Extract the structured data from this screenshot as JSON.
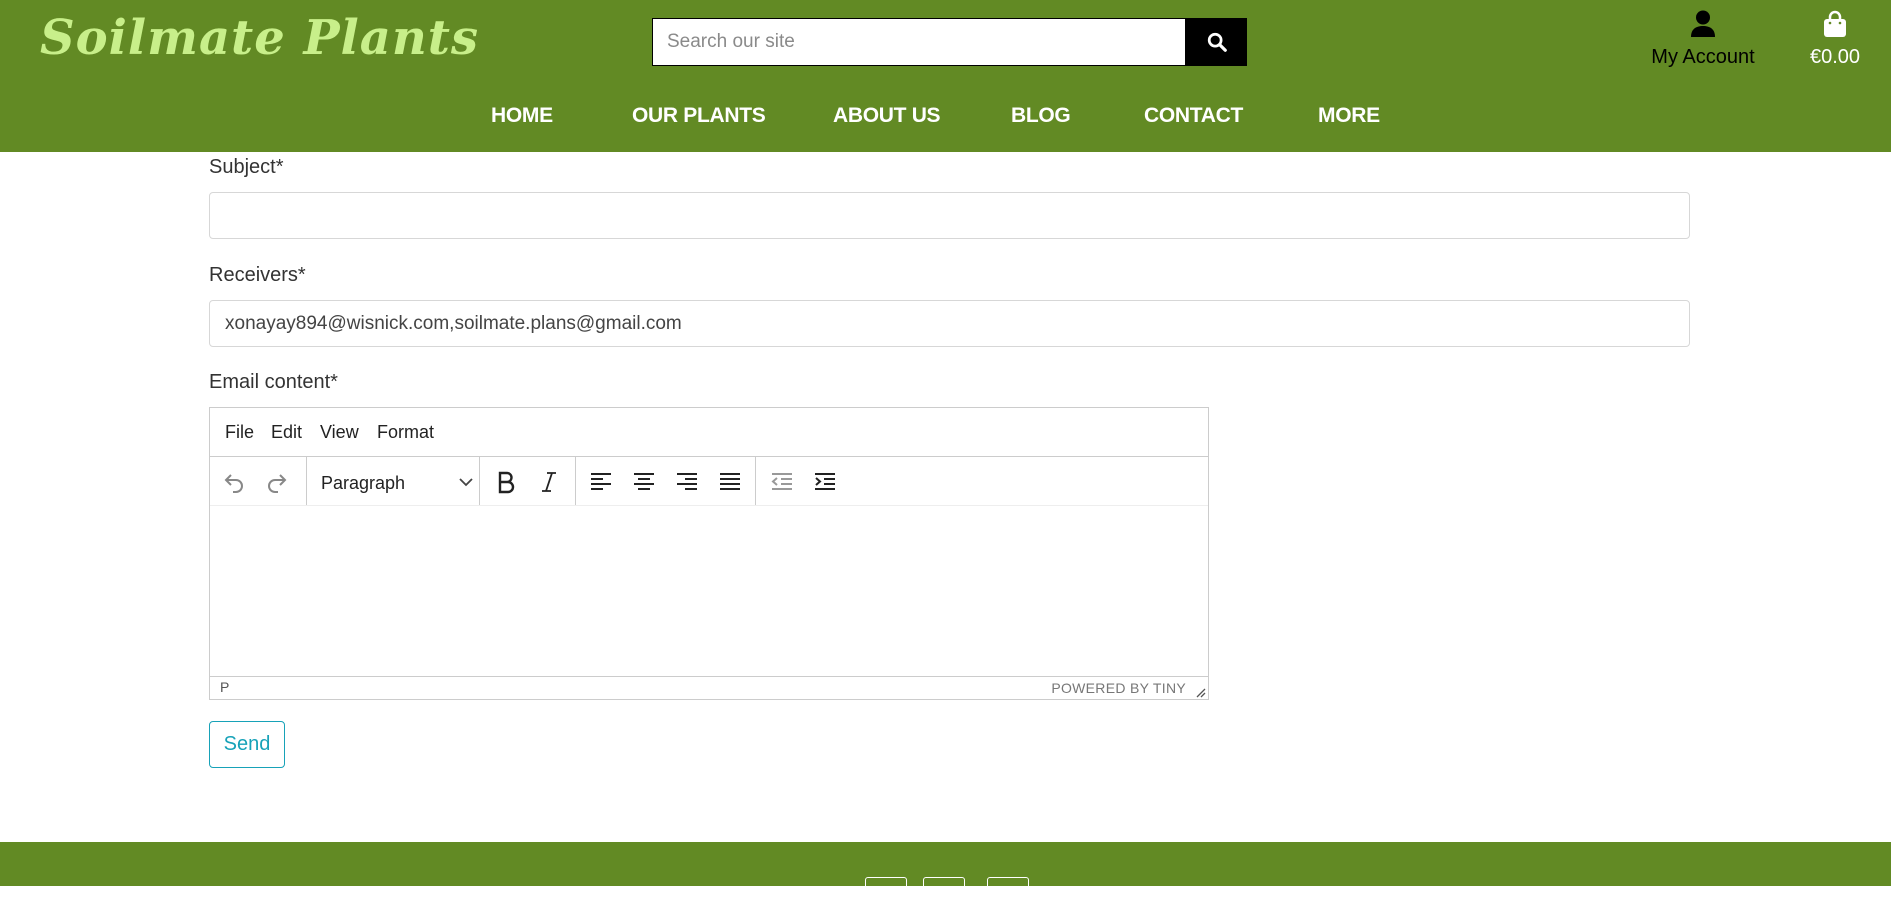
{
  "header": {
    "logo": "Soilmate Plants",
    "search_placeholder": "Search our site",
    "account_label": "My Account",
    "bag_total": "€0.00",
    "nav": [
      "HOME",
      "OUR PLANTS",
      "ABOUT US",
      "BLOG",
      "CONTACT",
      "MORE"
    ]
  },
  "form": {
    "subject_label": "Subject*",
    "subject_value": "",
    "receivers_label": "Receivers*",
    "receivers_value": "xonayay894@wisnick.com,soilmate.plans@gmail.com",
    "content_label": "Email content*",
    "send_label": "Send"
  },
  "editor": {
    "menus": [
      "File",
      "Edit",
      "View",
      "Format"
    ],
    "block_format": "Paragraph",
    "status_path": "P",
    "powered_by": "POWERED BY TINY"
  },
  "colors": {
    "brand_green": "#628a24",
    "logo_green": "#c8ef8a",
    "send_teal": "#17a2b8"
  }
}
